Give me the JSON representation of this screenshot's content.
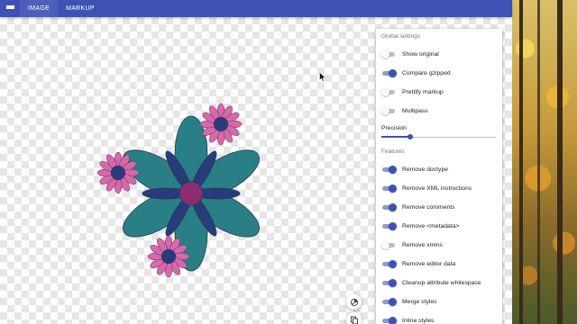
{
  "topbar": {
    "tabs": [
      {
        "label": "IMAGE",
        "active": true
      },
      {
        "label": "MARKUP",
        "active": false
      }
    ]
  },
  "panel": {
    "global_title": "Global settings",
    "global_options": [
      {
        "label": "Show original",
        "on": false
      },
      {
        "label": "Compare gzipped",
        "on": true
      },
      {
        "label": "Prettify markup",
        "on": false
      },
      {
        "label": "Multipass",
        "on": false
      }
    ],
    "precision": {
      "label": "Precision",
      "value_fraction": 0.25
    },
    "features_title": "Features",
    "features": [
      {
        "label": "Remove doctype",
        "on": true
      },
      {
        "label": "Remove XML instructions",
        "on": true
      },
      {
        "label": "Remove comments",
        "on": true
      },
      {
        "label": "Remove <metadata>",
        "on": true
      },
      {
        "label": "Remove xmlns",
        "on": false
      },
      {
        "label": "Remove editor data",
        "on": true
      },
      {
        "label": "Cleanup attribute whitespace",
        "on": true
      },
      {
        "label": "Merge styles",
        "on": true
      },
      {
        "label": "Inline styles",
        "on": true
      }
    ]
  },
  "icons": {
    "menu": "menu-icon",
    "fab_top": "drawing-compare-icon",
    "fab_bottom": "copy-icon"
  },
  "colors": {
    "accent": "#3f51b5",
    "petal_teal": "#2a7f86",
    "petal_navy": "#283b7a",
    "center_magenta": "#8e2c73",
    "small_flower_pink": "#d46aaa"
  }
}
